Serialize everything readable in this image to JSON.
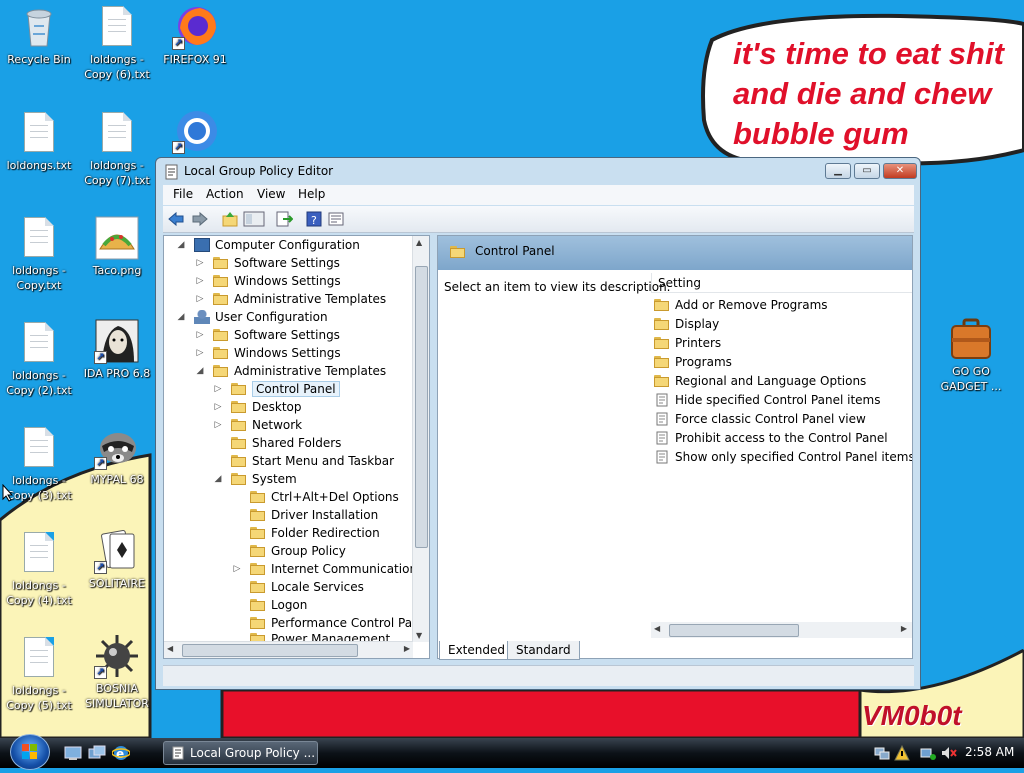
{
  "desktop": {
    "speech_bubble": [
      "it's time to eat shit",
      "and die and chew",
      "bubble gum"
    ],
    "watermark": "VM0b0t",
    "icons": [
      {
        "label": "Recycle Bin",
        "icon": "recycle-bin-icon"
      },
      {
        "label": "loldongs - Copy (6).txt",
        "icon": "text-file-icon"
      },
      {
        "label": "FIREFOX 91",
        "icon": "firefox-icon"
      },
      {
        "label": "loldongs.txt",
        "icon": "text-file-icon"
      },
      {
        "label": "loldongs - Copy (7).txt",
        "icon": "text-file-icon"
      },
      {
        "label": "loldongs - Copy.txt",
        "icon": "text-file-icon"
      },
      {
        "label": "Taco.png",
        "icon": "taco-image-icon"
      },
      {
        "label": "loldongs - Copy (2).txt",
        "icon": "text-file-icon"
      },
      {
        "label": "IDA PRO 6.8",
        "icon": "ida-pro-icon"
      },
      {
        "label": "loldongs - Copy (3).txt",
        "icon": "text-file-icon"
      },
      {
        "label": "MYPAL 68",
        "icon": "mypal-raccoon-icon"
      },
      {
        "label": "loldongs - Copy (4).txt",
        "icon": "text-file-icon"
      },
      {
        "label": "SOLITAIRE",
        "icon": "solitaire-icon"
      },
      {
        "label": "loldongs - Copy (5).txt",
        "icon": "text-file-icon"
      },
      {
        "label": "BOSNIA SIMULATOR",
        "icon": "minesweeper-mine-icon"
      },
      {
        "label": "GO GO GADGET ...",
        "icon": "briefcase-icon"
      }
    ]
  },
  "window": {
    "title": "Local Group Policy Editor",
    "menu": [
      "File",
      "Action",
      "View",
      "Help"
    ],
    "tree": [
      {
        "label": "Computer Configuration",
        "icon": "computer-icon",
        "expander": "◢"
      },
      {
        "label": "Software Settings",
        "icon": "folder-icon",
        "expander": "▷"
      },
      {
        "label": "Windows Settings",
        "icon": "folder-icon",
        "expander": "▷"
      },
      {
        "label": "Administrative Templates",
        "icon": "folder-icon",
        "expander": "▷"
      },
      {
        "label": "User Configuration",
        "icon": "user-icon",
        "expander": "◢"
      },
      {
        "label": "Software Settings",
        "icon": "folder-icon",
        "expander": "▷"
      },
      {
        "label": "Windows Settings",
        "icon": "folder-icon",
        "expander": "▷"
      },
      {
        "label": "Administrative Templates",
        "icon": "folder-icon",
        "expander": "◢"
      },
      {
        "label": "Control Panel",
        "icon": "folder-icon",
        "expander": "▷",
        "selected": true
      },
      {
        "label": "Desktop",
        "icon": "folder-icon",
        "expander": "▷"
      },
      {
        "label": "Network",
        "icon": "folder-icon",
        "expander": "▷"
      },
      {
        "label": "Shared Folders",
        "icon": "folder-icon",
        "expander": ""
      },
      {
        "label": "Start Menu and Taskbar",
        "icon": "folder-icon",
        "expander": ""
      },
      {
        "label": "System",
        "icon": "folder-icon",
        "expander": "◢"
      },
      {
        "label": "Ctrl+Alt+Del Options",
        "icon": "folder-icon",
        "expander": ""
      },
      {
        "label": "Driver Installation",
        "icon": "folder-icon",
        "expander": ""
      },
      {
        "label": "Folder Redirection",
        "icon": "folder-icon",
        "expander": ""
      },
      {
        "label": "Group Policy",
        "icon": "folder-icon",
        "expander": ""
      },
      {
        "label": "Internet Communication Ma",
        "icon": "folder-icon",
        "expander": "▷"
      },
      {
        "label": "Locale Services",
        "icon": "folder-icon",
        "expander": ""
      },
      {
        "label": "Logon",
        "icon": "folder-icon",
        "expander": ""
      },
      {
        "label": "Performance Control Panel",
        "icon": "folder-icon",
        "expander": ""
      },
      {
        "label": "Power Management",
        "icon": "folder-icon",
        "expander": ""
      }
    ],
    "right": {
      "header": "Control Panel",
      "description": "Select an item to view its description.",
      "column": "Setting",
      "items": [
        {
          "label": "Add or Remove Programs",
          "icon": "folder-icon"
        },
        {
          "label": "Display",
          "icon": "folder-icon"
        },
        {
          "label": "Printers",
          "icon": "folder-icon"
        },
        {
          "label": "Programs",
          "icon": "folder-icon"
        },
        {
          "label": "Regional and Language Options",
          "icon": "folder-icon"
        },
        {
          "label": "Hide specified Control Panel items",
          "icon": "policy-setting-icon"
        },
        {
          "label": "Force classic Control Panel view",
          "icon": "policy-setting-icon"
        },
        {
          "label": "Prohibit access to the Control Panel",
          "icon": "policy-setting-icon"
        },
        {
          "label": "Show only specified Control Panel items",
          "icon": "policy-setting-icon"
        }
      ],
      "tabs": [
        "Extended",
        "Standard"
      ]
    }
  },
  "taskbar": {
    "task_label": "Local Group Policy ...",
    "clock": "2:58 AM"
  },
  "colors": {
    "desktop_bg": "#1aa0e6",
    "bubble_text": "#e0102a",
    "watermark": "#c0102a"
  }
}
